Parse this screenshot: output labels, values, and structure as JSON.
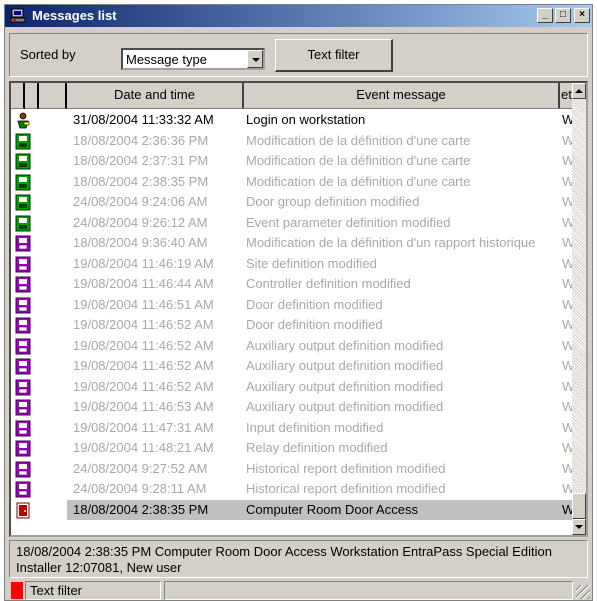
{
  "window": {
    "title": "Messages list",
    "icon": "app-workstation-icon"
  },
  "titlebar_buttons": {
    "minimize": "_",
    "maximize": "□",
    "close": "×"
  },
  "toolbar": {
    "sorted_by_label": "Sorted by",
    "sort_select_value": "Message type",
    "text_filter_label": "Text filter"
  },
  "list": {
    "columns": {
      "date_time": "Date and time",
      "event_message": "Event message",
      "workstation": "eta"
    },
    "rows": [
      {
        "icon": "user-login-icon",
        "date": "31/08/2004 11:33:32 AM",
        "message": "Login on workstation",
        "ws": "Wo",
        "state": "active"
      },
      {
        "icon": "green-definition-icon",
        "date": "18/08/2004 2:36:36 PM",
        "message": "Modification de la définition d'une carte",
        "ws": "Wo",
        "state": "dim"
      },
      {
        "icon": "green-definition-icon",
        "date": "18/08/2004 2:37:31 PM",
        "message": "Modification de la définition d'une carte",
        "ws": "Wo",
        "state": "dim"
      },
      {
        "icon": "green-definition-icon",
        "date": "18/08/2004 2:38:35 PM",
        "message": "Modification de la définition d'une carte",
        "ws": "Wo",
        "state": "dim"
      },
      {
        "icon": "green-definition-icon",
        "date": "24/08/2004 9:24:06 AM",
        "message": "Door group definition modified",
        "ws": "Wo",
        "state": "dim"
      },
      {
        "icon": "green-definition-icon",
        "date": "24/08/2004 9:26:12 AM",
        "message": "Event parameter definition modified",
        "ws": "Wo",
        "state": "dim"
      },
      {
        "icon": "purple-definition-icon",
        "date": "18/08/2004 9:36:40 AM",
        "message": "Modification de la définition d'un rapport historique",
        "ws": "Wo",
        "state": "dim"
      },
      {
        "icon": "purple-definition-icon",
        "date": "19/08/2004 11:46:19 AM",
        "message": "Site definition modified",
        "ws": "Wo",
        "state": "dim"
      },
      {
        "icon": "purple-definition-icon",
        "date": "19/08/2004 11:46:44 AM",
        "message": "Controller definition modified",
        "ws": "Wo",
        "state": "dim"
      },
      {
        "icon": "purple-definition-icon",
        "date": "19/08/2004 11:46:51 AM",
        "message": "Door definition modified",
        "ws": "Wo",
        "state": "dim"
      },
      {
        "icon": "purple-definition-icon",
        "date": "19/08/2004 11:46:52 AM",
        "message": "Door definition modified",
        "ws": "Wo",
        "state": "dim"
      },
      {
        "icon": "purple-definition-icon",
        "date": "19/08/2004 11:46:52 AM",
        "message": "Auxiliary output definition modified",
        "ws": "Wo",
        "state": "dim"
      },
      {
        "icon": "purple-definition-icon",
        "date": "19/08/2004 11:46:52 AM",
        "message": "Auxiliary output definition modified",
        "ws": "Wo",
        "state": "dim"
      },
      {
        "icon": "purple-definition-icon",
        "date": "19/08/2004 11:46:52 AM",
        "message": "Auxiliary output definition modified",
        "ws": "Wo",
        "state": "dim"
      },
      {
        "icon": "purple-definition-icon",
        "date": "19/08/2004 11:46:53 AM",
        "message": "Auxiliary output definition modified",
        "ws": "Wo",
        "state": "dim"
      },
      {
        "icon": "purple-definition-icon",
        "date": "19/08/2004 11:47:31 AM",
        "message": "Input definition modified",
        "ws": "Wo",
        "state": "dim"
      },
      {
        "icon": "purple-definition-icon",
        "date": "19/08/2004 11:48:21 AM",
        "message": "Relay definition modified",
        "ws": "Wo",
        "state": "dim"
      },
      {
        "icon": "purple-definition-icon",
        "date": "24/08/2004 9:27:52 AM",
        "message": "Historical report definition modified",
        "ws": "Wo",
        "state": "dim"
      },
      {
        "icon": "purple-definition-icon",
        "date": "24/08/2004 9:28:11 AM",
        "message": "Historical report definition modified",
        "ws": "Wo",
        "state": "dim"
      },
      {
        "icon": "door-access-icon",
        "date": "18/08/2004 2:38:35 PM",
        "message": "Computer Room Door Access",
        "ws": "Wo",
        "state": "selected"
      }
    ]
  },
  "detail": {
    "text": "18/08/2004 2:38:35 PM  Computer Room Door Access  Workstation EntraPass Special Edition  Installer  12:07081, New user"
  },
  "statusbar": {
    "filter_label": "Text filter",
    "indicator_color": "#ff0000"
  }
}
